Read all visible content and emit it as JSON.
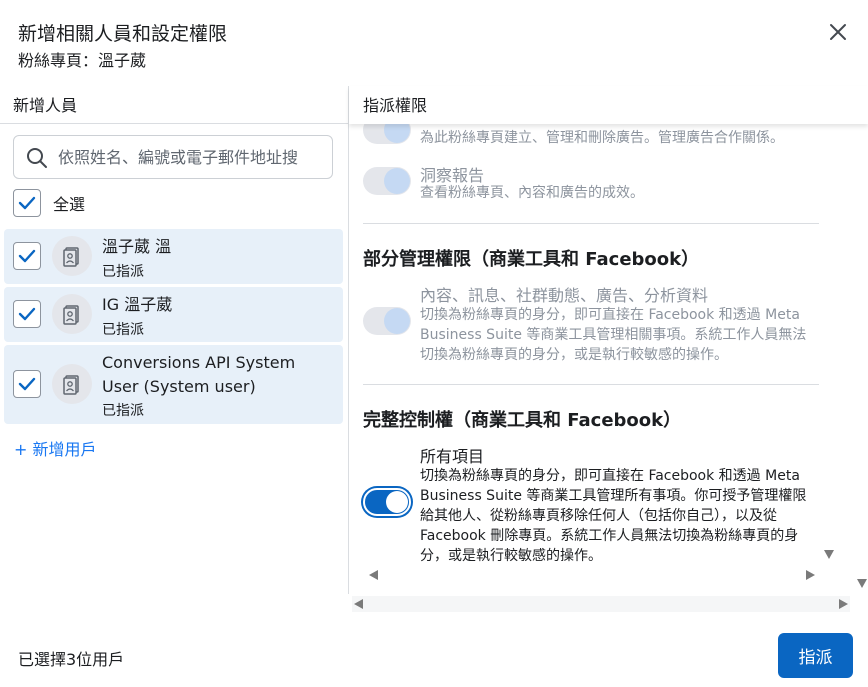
{
  "header": {
    "title": "新增相關人員和設定權限",
    "subtitle": "粉絲專頁：溫子葳"
  },
  "left": {
    "heading": "新增人員",
    "search": {
      "placeholder": "依照姓名、編號或電子郵件地址搜",
      "value": ""
    },
    "select_all_label": "全選",
    "users": [
      {
        "name": "溫子葳 溫",
        "status": "已指派",
        "checked": true
      },
      {
        "name": "IG 溫子葳",
        "status": "已指派",
        "checked": true
      },
      {
        "name": "Conversions API System User (System user)",
        "status": "已指派",
        "checked": true
      }
    ],
    "add_user_label": "+ 新增用戶"
  },
  "right": {
    "heading": "指派權限",
    "ads_desc": "為此粉絲專頁建立、管理和刪除廣告。管理廣告合作關係。",
    "insights_title": "洞察報告",
    "insights_desc": "查看粉絲專頁、內容和廣告的成效。",
    "partial_section": "部分管理權限（商業工具和 Facebook）",
    "partial_title": "內容、訊息、社群動態、廣告、分析資料",
    "partial_desc": "切換為粉絲專頁的身分，即可直接在 Facebook 和透過 Meta Business Suite 等商業工具管理相關事項。系統工作人員無法切換為粉絲專頁的身分，或是執行較敏感的操作。",
    "full_section": "完整控制權（商業工具和 Facebook）",
    "full_title": "所有項目",
    "full_desc": "切換為粉絲專頁的身分，即可直接在 Facebook 和透過 Meta Business Suite 等商業工具管理所有事項。你可授予管理權限給其他人、從粉絲專頁移除任何人（包括你自己），以及從 Facebook 刪除專頁。系統工作人員無法切換為粉絲專頁的身分，或是執行較敏感的操作。",
    "full_toggle_on": true
  },
  "footer": {
    "selected_text": "已選擇3位用戶",
    "assign_label": "指派"
  },
  "colors": {
    "primary": "#0a66c2",
    "selected_row": "#e7f0f9",
    "link": "#1877f2"
  }
}
